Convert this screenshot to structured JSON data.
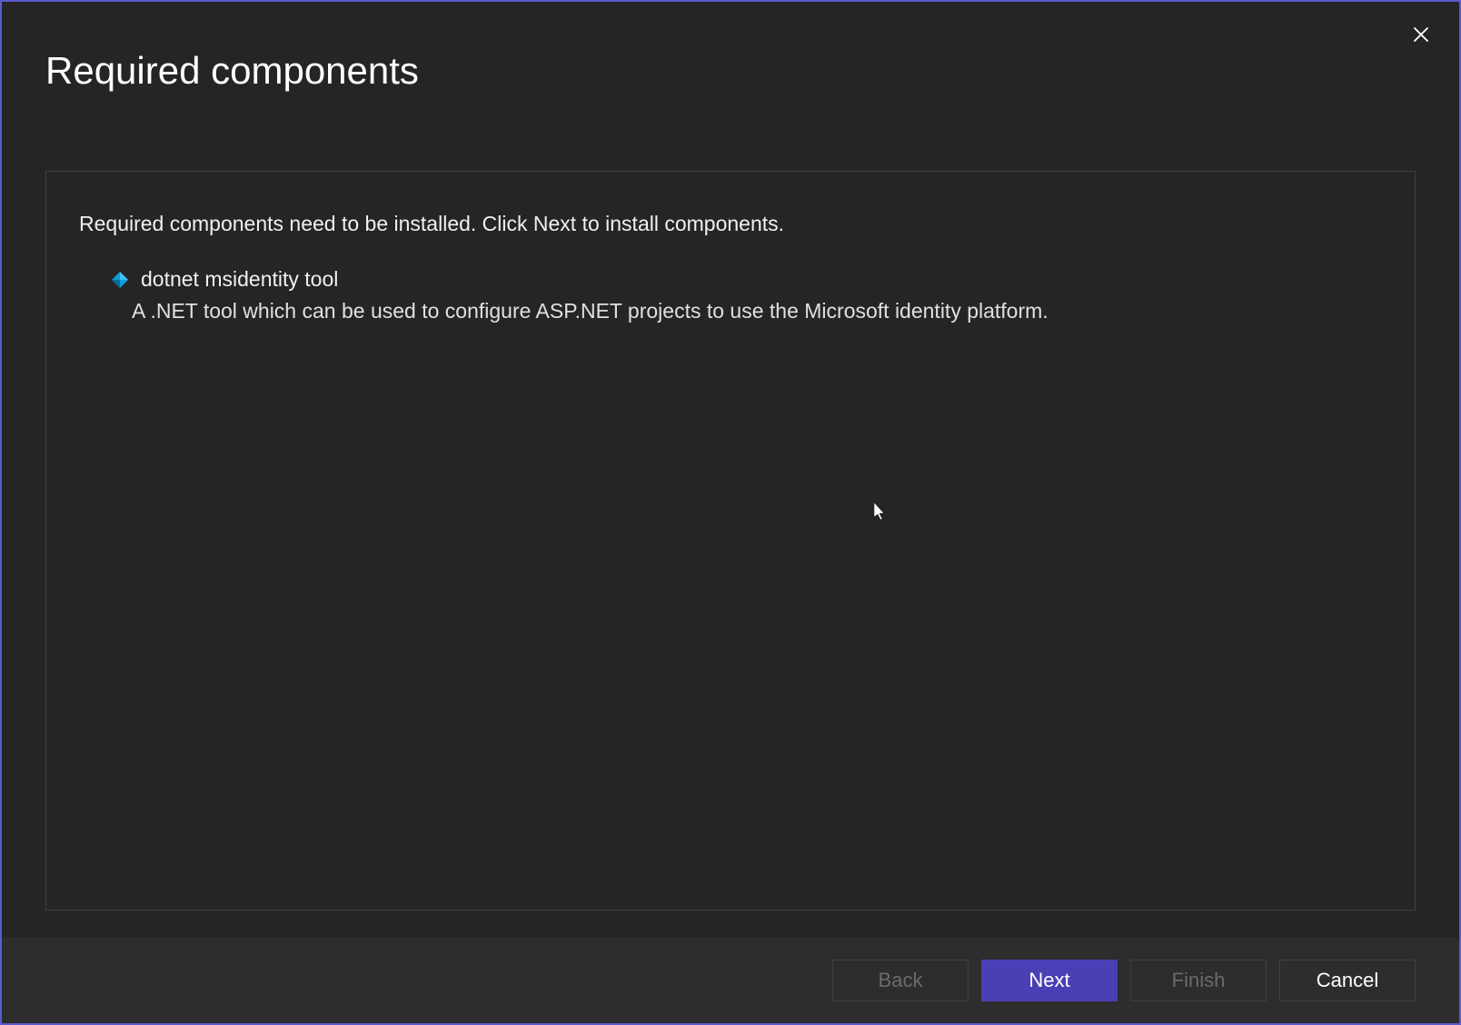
{
  "dialog": {
    "title": "Required components"
  },
  "content": {
    "instruction": "Required components need to be installed. Click Next to install components.",
    "components": [
      {
        "name": "dotnet msidentity tool",
        "description": "A .NET tool which can be used to configure ASP.NET projects to use the Microsoft identity platform."
      }
    ]
  },
  "footer": {
    "back_label": "Back",
    "next_label": "Next",
    "finish_label": "Finish",
    "cancel_label": "Cancel"
  }
}
